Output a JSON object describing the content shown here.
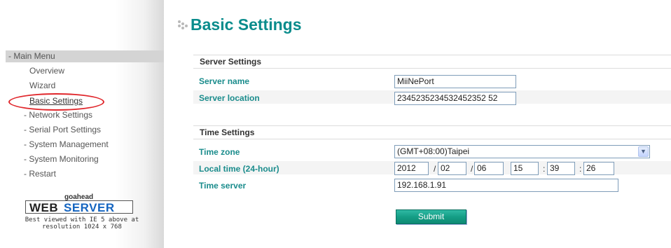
{
  "sidebar": {
    "menu_header": "- Main Menu",
    "items": [
      {
        "label": "Overview"
      },
      {
        "label": "Wizard"
      },
      {
        "label": "Basic Settings"
      },
      {
        "label": "- Network Settings"
      },
      {
        "label": "- Serial Port Settings"
      },
      {
        "label": "- System Management"
      },
      {
        "label": "- System Monitoring"
      },
      {
        "label": "- Restart"
      }
    ],
    "logo": {
      "top": "goahead",
      "web": "WEB",
      "server": "SERVER"
    },
    "best_viewed_line1": "Best viewed with IE 5 above at",
    "best_viewed_line2": "resolution 1024 x 768"
  },
  "page": {
    "title": "Basic Settings"
  },
  "server_settings": {
    "header": "Server Settings",
    "server_name_label": "Server name",
    "server_name_value": "MiiNePort",
    "server_location_label": "Server location",
    "server_location_value": "2345235234532452352 52"
  },
  "time_settings": {
    "header": "Time Settings",
    "time_zone_label": "Time zone",
    "time_zone_value": "(GMT+08:00)Taipei",
    "local_time_label": "Local time (24-hour)",
    "year": "2012",
    "month": "02",
    "day": "06",
    "hour": "15",
    "minute": "39",
    "second": "26",
    "date_sep": "/",
    "time_sep": ":",
    "time_server_label": "Time server",
    "time_server_value": "192.168.1.91"
  },
  "actions": {
    "submit_label": "Submit"
  },
  "colors": {
    "accent": "#0a8c8c",
    "label": "#1a8c8c",
    "highlight": "#e0262b",
    "button": "#159e86"
  }
}
